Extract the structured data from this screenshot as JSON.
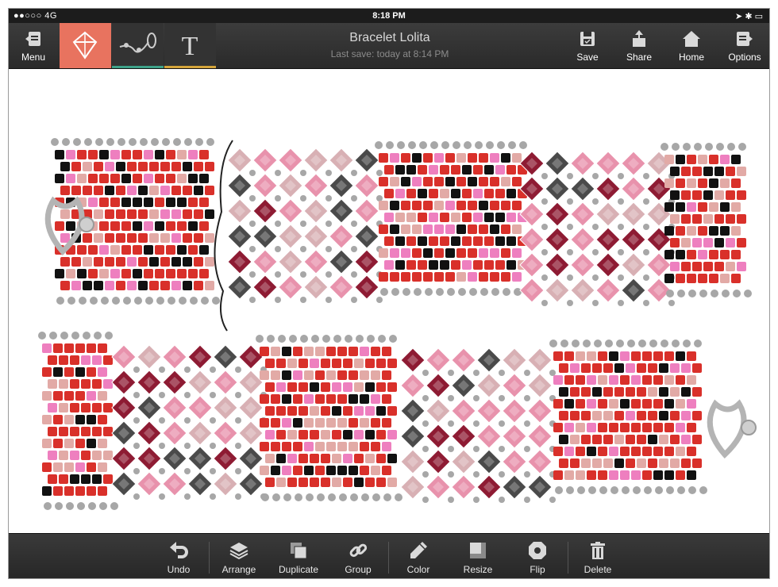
{
  "status_bar": {
    "signal": "●●○○○",
    "network": "4G",
    "time": "8:18 PM"
  },
  "toolbar": {
    "menu_label": "Menu",
    "document_title": "Bracelet Lolita",
    "last_save": "Last save: today at 8:14 PM",
    "save_label": "Save",
    "share_label": "Share",
    "home_label": "Home",
    "options_label": "Options",
    "tool_tabs": [
      {
        "icon": "bead-icon",
        "accent": "#e8735f"
      },
      {
        "icon": "thread-path-icon",
        "accent": "#3fa38a"
      },
      {
        "icon": "text-icon",
        "accent": "#d4a43a"
      }
    ]
  },
  "bottom_bar": {
    "items": [
      {
        "label": "Undo",
        "icon": "undo-icon"
      },
      {
        "label": "Arrange",
        "icon": "layers-icon"
      },
      {
        "label": "Duplicate",
        "icon": "duplicate-icon"
      },
      {
        "label": "Group",
        "icon": "link-icon"
      },
      {
        "label": "Color",
        "icon": "pencil-icon"
      },
      {
        "label": "Resize",
        "icon": "resize-icon"
      },
      {
        "label": "Flip",
        "icon": "flip-icon"
      },
      {
        "label": "Delete",
        "icon": "trash-icon"
      }
    ]
  },
  "colors": {
    "accent_orange": "#e8735f",
    "accent_green": "#3fa38a",
    "accent_yellow": "#d4a43a",
    "bead_red": "#d9302a",
    "bead_black": "#111111",
    "bead_pink": "#ee7fbf",
    "bead_blush": "#e2aaa6",
    "bead_gray": "#a7a7a7",
    "crystal_dark_red": "#8e1b33",
    "crystal_pink": "#e892ac",
    "crystal_light": "#d8b0b4",
    "crystal_gray": "#4a4a4a"
  }
}
